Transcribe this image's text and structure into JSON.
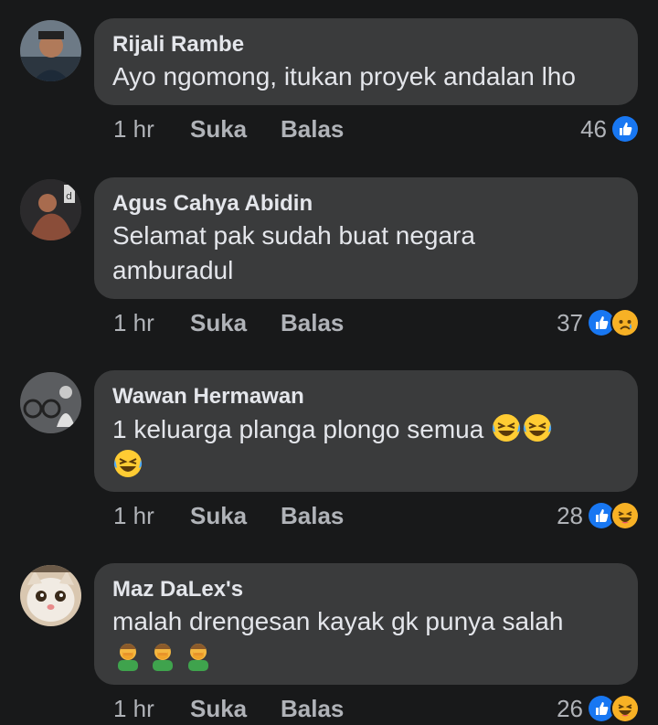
{
  "colors": {
    "background": "#18191a",
    "bubble": "#3a3b3c",
    "primary_text": "#e4e6eb",
    "secondary_text": "#b0b3b8",
    "like_blue": "#1877f2"
  },
  "comments": [
    {
      "author": "Rijali Rambe",
      "text_lines": [
        "Ayo ngomong, itukan proyek andalan lho"
      ],
      "time": "1 hr",
      "like_label": "Suka",
      "reply_label": "Balas",
      "reaction_count": "46",
      "reaction_icons": [
        "like-icon"
      ]
    },
    {
      "author": "Agus Cahya Abidin",
      "text_lines": [
        "Selamat pak sudah buat negara",
        "amburadul"
      ],
      "time": "1 hr",
      "like_label": "Suka",
      "reply_label": "Balas",
      "reaction_count": "37",
      "reaction_icons": [
        "like-icon",
        "sad-icon"
      ]
    },
    {
      "author": "Wawan Hermawan",
      "text_lines": [
        "1 keluarga planga plongo semua"
      ],
      "emoji_after_text": [
        "rolling-laughing-emoji",
        "rolling-laughing-emoji"
      ],
      "emoji_row": [
        "rolling-laughing-emoji"
      ],
      "time": "1 hr",
      "like_label": "Suka",
      "reply_label": "Balas",
      "reaction_count": "28",
      "reaction_icons": [
        "like-icon",
        "haha-icon"
      ]
    },
    {
      "author": "Maz DaLex's",
      "text_lines": [
        "malah drengesan kayak gk punya salah"
      ],
      "emoji_row": [
        "facepalm-emoji",
        "facepalm-emoji",
        "facepalm-emoji"
      ],
      "time": "1 hr",
      "like_label": "Suka",
      "reply_label": "Balas",
      "reaction_count": "26",
      "reaction_icons": [
        "like-icon",
        "haha-icon"
      ]
    }
  ]
}
